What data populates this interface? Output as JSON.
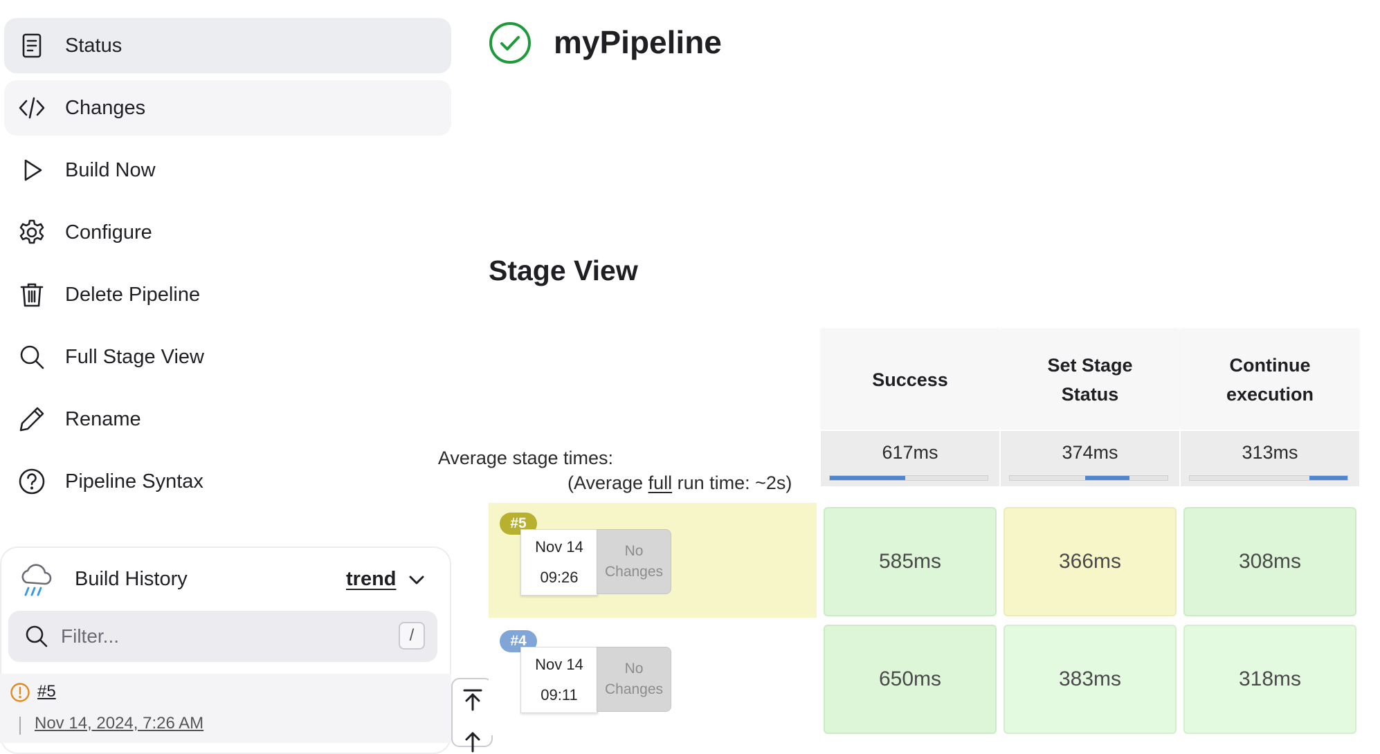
{
  "sidebar": {
    "items": [
      {
        "label": "Status",
        "icon": "document-icon"
      },
      {
        "label": "Changes",
        "icon": "code-icon"
      },
      {
        "label": "Build Now",
        "icon": "play-icon"
      },
      {
        "label": "Configure",
        "icon": "gear-icon"
      },
      {
        "label": "Delete Pipeline",
        "icon": "trash-icon"
      },
      {
        "label": "Full Stage View",
        "icon": "search-icon"
      },
      {
        "label": "Rename",
        "icon": "pencil-icon"
      },
      {
        "label": "Pipeline Syntax",
        "icon": "question-icon"
      }
    ]
  },
  "build_history": {
    "title": "Build History",
    "trend_label": "trend",
    "filter": {
      "placeholder": "Filter...",
      "shortcut": "/"
    },
    "entries": [
      {
        "number": "#5",
        "date": "Nov 14, 2024, 7:26 AM",
        "status": "unstable"
      }
    ]
  },
  "header": {
    "title": "myPipeline",
    "status": "success"
  },
  "stage_view": {
    "title": "Stage View",
    "avg_label": "Average stage times:",
    "avg_full_prefix": "(Average ",
    "avg_full_link": "full",
    "avg_full_suffix": " run time: ~2s)",
    "stages": [
      {
        "name_line1": "Success",
        "name_line2": "",
        "avg": "617ms",
        "avg_fill_start": 0.0,
        "avg_fill_end": 0.48
      },
      {
        "name_line1": "Set Stage",
        "name_line2": "Status",
        "avg": "374ms",
        "avg_fill_start": 0.48,
        "avg_fill_end": 0.76
      },
      {
        "name_line1": "Continue",
        "name_line2": "execution",
        "avg": "313ms",
        "avg_fill_start": 0.76,
        "avg_fill_end": 1.0
      }
    ],
    "runs": [
      {
        "badge": "#5",
        "date": "Nov 14",
        "time": "09:26",
        "changes": "No Changes",
        "status": "unstable",
        "cells": [
          {
            "value": "585ms",
            "status": "success"
          },
          {
            "value": "366ms",
            "status": "unstable"
          },
          {
            "value": "308ms",
            "status": "success"
          }
        ]
      },
      {
        "badge": "#4",
        "date": "Nov 14",
        "time": "09:11",
        "changes": "No Changes",
        "status": "success",
        "cells": [
          {
            "value": "650ms",
            "status": "success"
          },
          {
            "value": "383ms",
            "status": "success-light"
          },
          {
            "value": "318ms",
            "status": "success-light"
          }
        ]
      }
    ]
  },
  "colors": {
    "success_icon": "#1e9a3a",
    "badge_unstable": "#b7b12f",
    "badge_success": "#7fa6d6",
    "row_unstable_bg": "#f7f6c9",
    "avg_bar": "#4f86d1"
  }
}
